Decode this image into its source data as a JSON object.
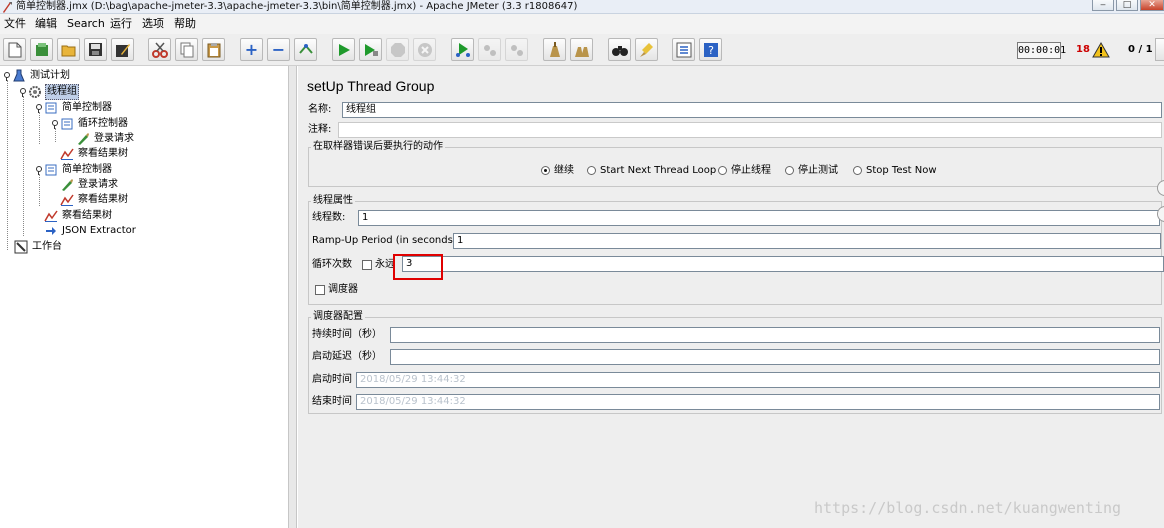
{
  "window": {
    "title": "简单控制器.jmx (D:\\bag\\apache-jmeter-3.3\\apache-jmeter-3.3\\bin\\简单控制器.jmx) - Apache JMeter (3.3 r1808647)"
  },
  "menu": [
    "文件",
    "编辑",
    "Search",
    "运行",
    "选项",
    "帮助"
  ],
  "toolbar": {
    "icons": [
      "new-icon",
      "templates-icon",
      "open-icon",
      "save-icon",
      "save-as-icon",
      "cut-icon",
      "copy-icon",
      "paste-icon",
      "expand-icon",
      "collapse-icon",
      "toggle-icon",
      "start-icon",
      "start-no-pause-icon",
      "stop-icon",
      "shutdown-icon",
      "remote-start-icon",
      "remote-stop-icon",
      "remote-shutdown-icon",
      "clear-icon",
      "clear-all-icon",
      "search-icon",
      "reset-search-icon",
      "function-helper-icon",
      "help-icon"
    ],
    "elapsed": "00:00:01",
    "error_count": "18",
    "active_threads": "0 / 1"
  },
  "tree": {
    "test_plan": "测试计划",
    "thread_group": "线程组",
    "simple_controller_1": "简单控制器",
    "loop_controller": "循环控制器",
    "login_request_1": "登录请求",
    "view_results_tree_1": "察看结果树",
    "simple_controller_2": "简单控制器",
    "login_request_2": "登录请求",
    "view_results_tree_2": "察看结果树",
    "view_results_tree_3": "察看结果树",
    "json_extractor": "JSON Extractor",
    "workbench": "工作台"
  },
  "panel": {
    "title": "setUp Thread Group",
    "name_label": "名称:",
    "name_value": "线程组",
    "comment_label": "注释:",
    "comment_value": "",
    "error_action": {
      "title": "在取样器错误后要执行的动作",
      "options": [
        "继续",
        "Start Next Thread Loop",
        "停止线程",
        "停止测试",
        "Stop Test Now"
      ],
      "selected": "继续"
    },
    "thread_props": {
      "title": "线程属性",
      "threads_label": "线程数:",
      "threads_value": "1",
      "rampup_label": "Ramp-Up Period (in seconds):",
      "rampup_value": "1",
      "loop_label": "循环次数",
      "forever_label": "永远",
      "loop_value": "3",
      "scheduler_label": "调度器"
    },
    "scheduler_config": {
      "title": "调度器配置",
      "duration_label": "持续时间（秒）",
      "duration_value": "",
      "delay_label": "启动延迟（秒）",
      "delay_value": "",
      "start_label": "启动时间",
      "start_value": "2018/05/29 13:44:32",
      "end_label": "结束时间",
      "end_value": "2018/05/29 13:44:32"
    }
  },
  "watermark": "https://blog.csdn.net/kuangwenting",
  "colors": {
    "highlight": "#e00000",
    "selection": "#bfcfe8",
    "error_count": "#cc0000"
  }
}
